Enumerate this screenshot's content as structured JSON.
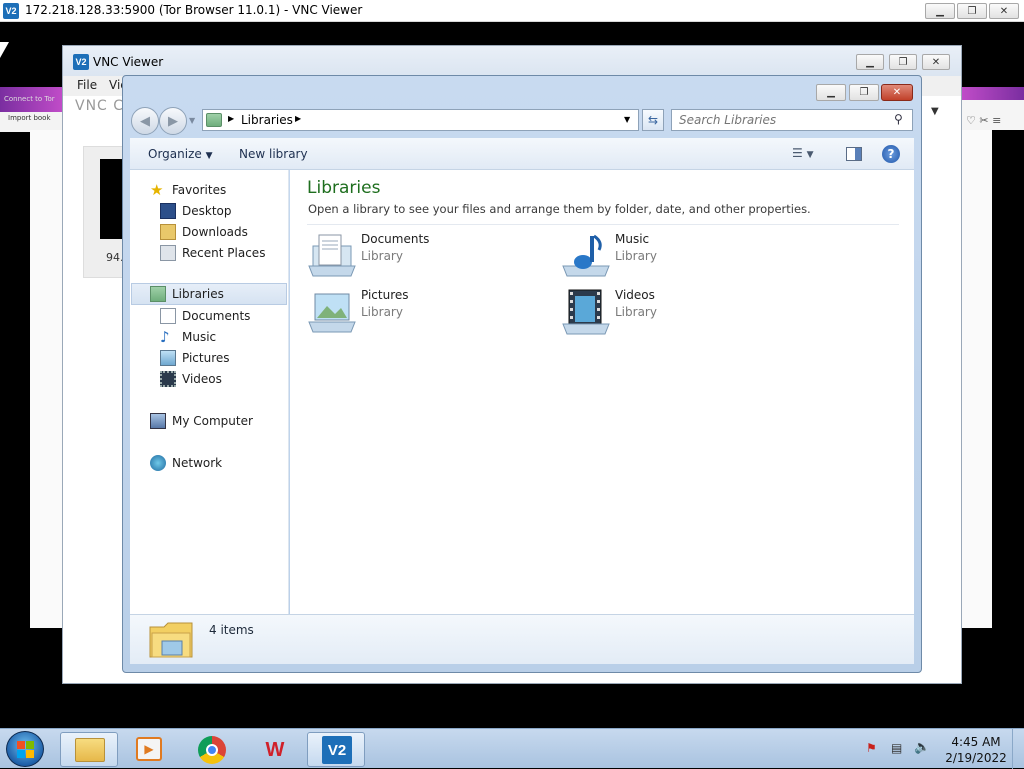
{
  "outer_window": {
    "title": "172.218.128.33:5900 (Tor Browser 11.0.1) - VNC Viewer",
    "minimize": "▁",
    "restore": "❐",
    "close": "✕"
  },
  "vnc_viewer": {
    "title": "VNC Viewer",
    "menu": [
      "File",
      "Vie"
    ],
    "brand_partial": "VNC CO",
    "tile_label_partial": "94."
  },
  "tor_background": {
    "strip_text": "Connect to Tor",
    "bookmarks_partial": "Import book"
  },
  "explorer": {
    "breadcrumb": "Libraries",
    "search_placeholder": "Search Libraries",
    "toolbar": {
      "organize": "Organize",
      "new_library": "New library"
    },
    "nav": {
      "favorites": "Favorites",
      "favorites_items": [
        "Desktop",
        "Downloads",
        "Recent Places"
      ],
      "libraries": "Libraries",
      "libraries_items": [
        "Documents",
        "Music",
        "Pictures",
        "Videos"
      ],
      "computer": "My Computer",
      "network": "Network"
    },
    "content": {
      "heading": "Libraries",
      "description": "Open a library to see your files and arrange them by folder, date, and other properties.",
      "libraries": [
        {
          "name": "Documents",
          "type": "Library",
          "icon": "documents-library-icon"
        },
        {
          "name": "Music",
          "type": "Library",
          "icon": "music-library-icon"
        },
        {
          "name": "Pictures",
          "type": "Library",
          "icon": "pictures-library-icon"
        },
        {
          "name": "Videos",
          "type": "Library",
          "icon": "videos-library-icon"
        }
      ]
    },
    "details": {
      "count": "4 items"
    },
    "accent": "#1e6e1e"
  },
  "taskbar": {
    "time": "4:45 AM",
    "date": "2/19/2022"
  }
}
